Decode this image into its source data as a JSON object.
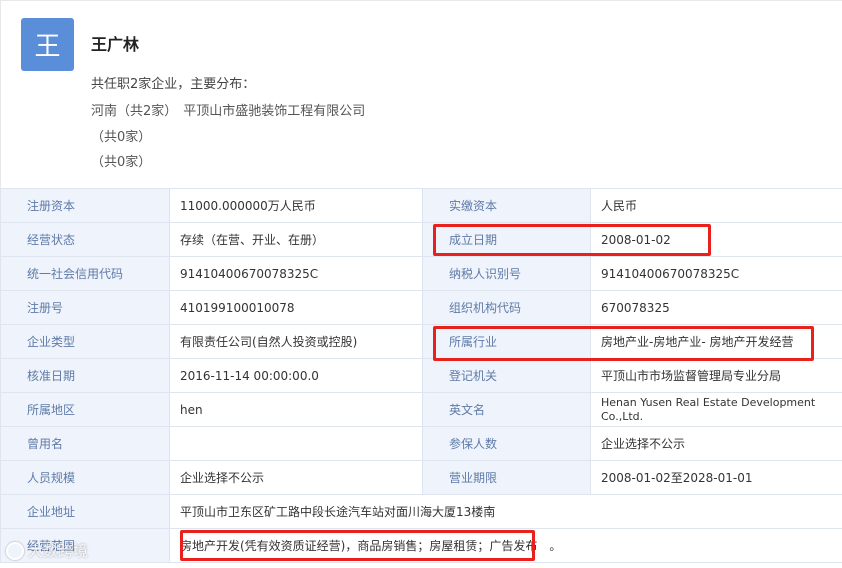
{
  "person": {
    "avatar_char": "王",
    "name": "王广林",
    "summary": "共任职2家企业，主要分布：",
    "regions": [
      {
        "name": "河南（共2家）",
        "company": "平顶山市盛驰装饰工程有限公司"
      },
      {
        "name": "（共0家）",
        "company": ""
      },
      {
        "name": "（共0家）",
        "company": ""
      }
    ]
  },
  "info": {
    "rows": [
      {
        "l1": "注册资本",
        "v1": "11000.000000万人民币",
        "l2": "实缴资本",
        "v2": "人民币"
      },
      {
        "l1": "经营状态",
        "v1": "存续（在营、开业、在册）",
        "l2": "成立日期",
        "v2": "2008-01-02"
      },
      {
        "l1": "统一社会信用代码",
        "v1": "91410400670078325C",
        "l2": "纳税人识别号",
        "v2": "91410400670078325C"
      },
      {
        "l1": "注册号",
        "v1": "410199100010078",
        "l2": "组织机构代码",
        "v2": "670078325"
      },
      {
        "l1": "企业类型",
        "v1": "有限责任公司(自然人投资或控股)",
        "l2": "所属行业",
        "v2": "房地产业-房地产业- 房地产开发经营"
      },
      {
        "l1": "核准日期",
        "v1": "2016-11-14 00:00:00.0",
        "l2": "登记机关",
        "v2": "平顶山市市场监督管理局专业分局"
      },
      {
        "l1": "所属地区",
        "v1": "hen",
        "l2": "英文名",
        "v2": "Henan Yusen Real Estate Development Co.,Ltd."
      },
      {
        "l1": "曾用名",
        "v1": "",
        "l2": "参保人数",
        "v2": "企业选择不公示"
      },
      {
        "l1": "人员规模",
        "v1": "企业选择不公示",
        "l2": "营业期限",
        "v2": "2008-01-02至2028-01-01"
      }
    ],
    "address_label": "企业地址",
    "address": "平顶山市卫东区矿工路中段长途汽车站对面川海大厦13楼南",
    "scope_label": "经营范围",
    "scope": "房地产开发(凭有效资质证经营)，商品房销售；房屋租赁；广告发布",
    "scope_tail": "。"
  },
  "watermark": "大数跨境",
  "colors": {
    "avatar": "#5b8ed9",
    "highlight": "#e8211d",
    "label_bg": "#eef3fc",
    "label_text": "#5f7ba8"
  }
}
